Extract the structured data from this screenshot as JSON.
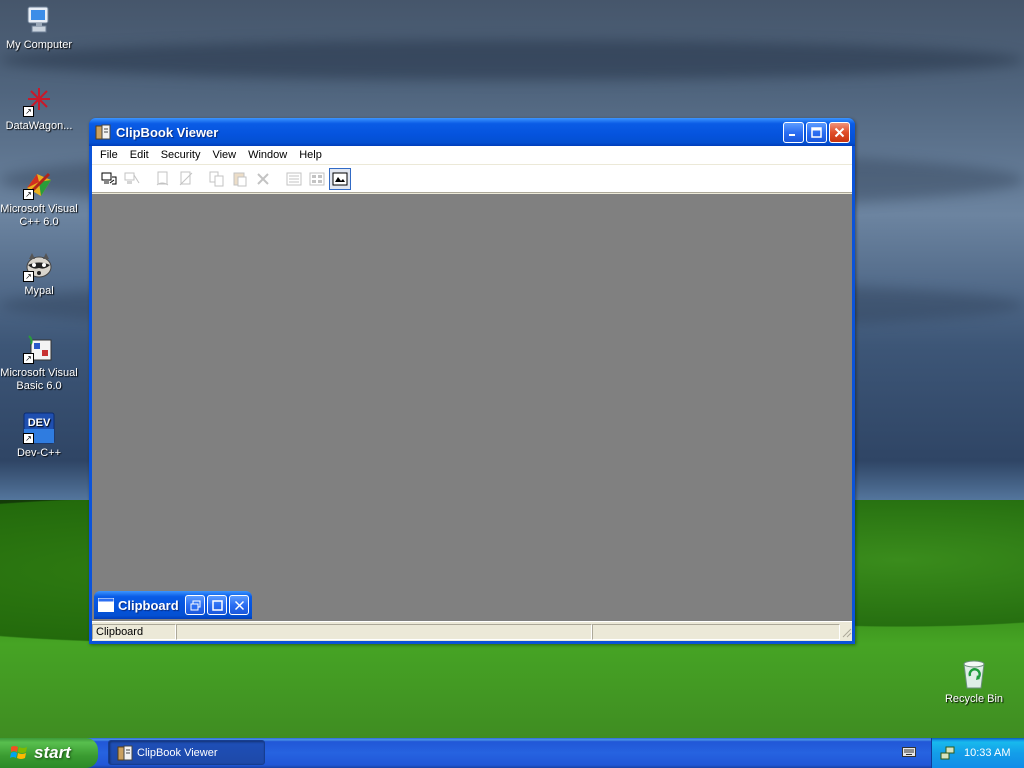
{
  "desktop": {
    "icons": [
      {
        "label": "My Computer"
      },
      {
        "label": "DataWagon..."
      },
      {
        "label": "Microsoft Visual C++ 6.0"
      },
      {
        "label": "Mypal"
      },
      {
        "label": "Microsoft Visual Basic 6.0"
      },
      {
        "label": "Dev-C++"
      },
      {
        "label": "Recycle Bin"
      }
    ],
    "devcpp_badge": "DEV"
  },
  "window": {
    "title": "ClipBook Viewer",
    "menu": [
      "File",
      "Edit",
      "Security",
      "View",
      "Window",
      "Help"
    ],
    "toolbar": {
      "buttons": [
        {
          "icon": "connect-icon",
          "enabled": true
        },
        {
          "icon": "disconnect-icon",
          "enabled": false
        },
        {
          "icon": "share-icon",
          "enabled": false
        },
        {
          "icon": "stop-sharing-icon",
          "enabled": false
        },
        {
          "icon": "copy-icon",
          "enabled": false
        },
        {
          "icon": "paste-icon",
          "enabled": false
        },
        {
          "icon": "delete-icon",
          "enabled": false
        },
        {
          "icon": "table-of-contents-icon",
          "enabled": false
        },
        {
          "icon": "thumbnails-icon",
          "enabled": false
        },
        {
          "icon": "full-page-icon",
          "enabled": true,
          "pressed": true
        }
      ]
    },
    "minimized_child": {
      "title": "Clipboard"
    },
    "status": {
      "text": "Clipboard"
    }
  },
  "taskbar": {
    "start_label": "start",
    "tasks": [
      {
        "label": "ClipBook Viewer"
      }
    ],
    "clock": "10:33 AM"
  },
  "colors": {
    "titlebar_blue": "#0553dd",
    "start_green": "#3a9b31",
    "tray_blue": "#139ee9",
    "mdi_gray": "#808080",
    "close_red": "#e04e2a"
  }
}
